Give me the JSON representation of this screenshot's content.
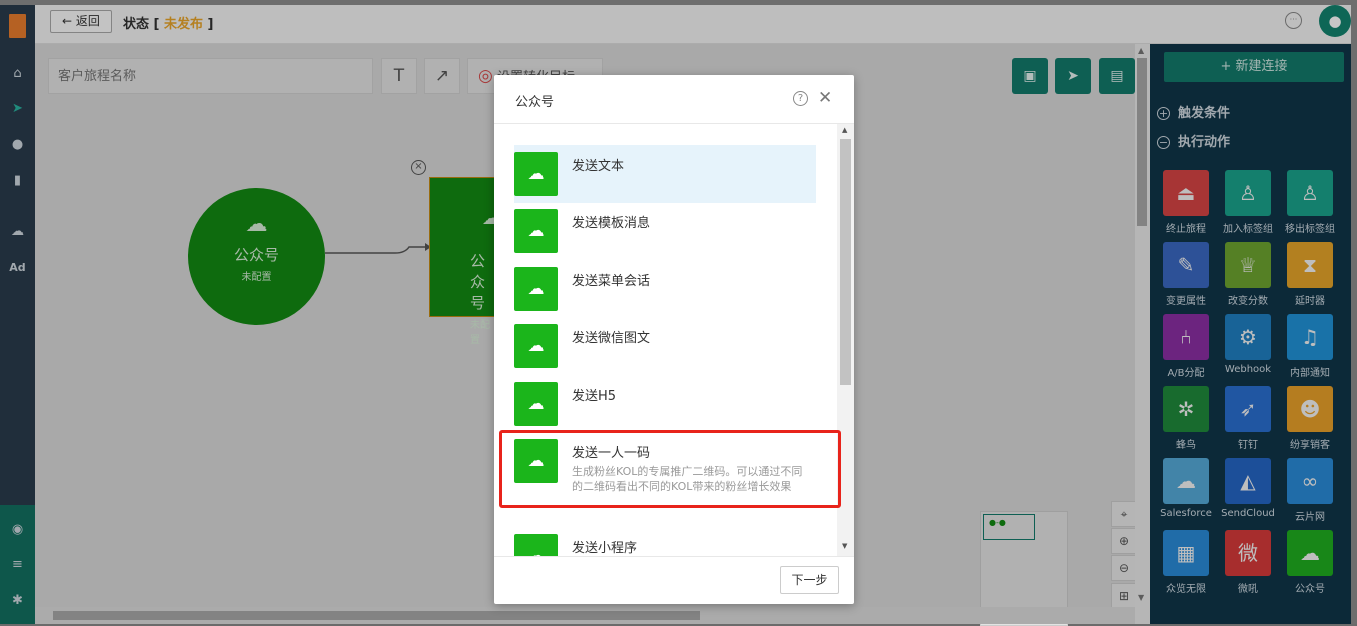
{
  "header": {
    "back_label": "返回",
    "status_prefix": "状态 [ ",
    "status_value": "未发布",
    "status_suffix": " ]"
  },
  "toolbar": {
    "journey_name_placeholder": "客户旅程名称",
    "text_tool": "T",
    "arrow_tool": "↗",
    "goal_label": "设置转化目标"
  },
  "canvas": {
    "node1": {
      "name": "公众号",
      "status": "未配置"
    },
    "node2": {
      "name": "公众号",
      "status": "未配置"
    }
  },
  "right_panel": {
    "new_connection": "+ 新建连接",
    "sections": {
      "triggers": "触发条件",
      "actions": "执行动作"
    },
    "actions": [
      {
        "label": "终止旅程",
        "icon": "eject-icon",
        "color": "#d64545"
      },
      {
        "label": "加入标签组",
        "icon": "user-add-icon",
        "color": "#1aa38c"
      },
      {
        "label": "移出标签组",
        "icon": "user-remove-icon",
        "color": "#1aa38c"
      },
      {
        "label": "变更属性",
        "icon": "edit-icon",
        "color": "#3a68c2"
      },
      {
        "label": "改变分数",
        "icon": "trophy-icon",
        "color": "#6da530"
      },
      {
        "label": "延时器",
        "icon": "hourglass-icon",
        "color": "#e6a52a"
      },
      {
        "label": "A/B分配",
        "icon": "split-icon",
        "color": "#8b2fa3"
      },
      {
        "label": "Webhook",
        "icon": "webhook-icon",
        "color": "#1f7fc2"
      },
      {
        "label": "内部通知",
        "icon": "bell-icon",
        "color": "#2192d8"
      },
      {
        "label": "蜂鸟",
        "icon": "spider-icon",
        "color": "#1f8a3b"
      },
      {
        "label": "钉钉",
        "icon": "dingtalk-icon",
        "color": "#2a6fd0"
      },
      {
        "label": "纷享销客",
        "icon": "fxiaoke-icon",
        "color": "#e8a02a"
      },
      {
        "label": "Salesforce",
        "icon": "cloud-icon",
        "color": "#55a9d8"
      },
      {
        "label": "SendCloud",
        "icon": "sendcloud-icon",
        "color": "#2566c4"
      },
      {
        "label": "云片网",
        "icon": "yunpian-icon",
        "color": "#2a8bd8"
      },
      {
        "label": "众览无限",
        "icon": "zhonglan-icon",
        "color": "#2a8bd8"
      },
      {
        "label": "微吼",
        "icon": "vhall-icon",
        "color": "#d63a3a"
      },
      {
        "label": "公众号",
        "icon": "wechat-icon",
        "color": "#1fae1f"
      }
    ]
  },
  "modal": {
    "title": "公众号",
    "items": [
      {
        "title": "发送文本",
        "desc": ""
      },
      {
        "title": "发送模板消息",
        "desc": ""
      },
      {
        "title": "发送菜单会话",
        "desc": ""
      },
      {
        "title": "发送微信图文",
        "desc": ""
      },
      {
        "title": "发送H5",
        "desc": ""
      },
      {
        "title": "发送一人一码",
        "desc": "生成粉丝KOL的专属推广二维码。可以通过不同的二维码看出不同的KOL带来的粉丝增长效果"
      },
      {
        "title": "发送小程序",
        "desc": ""
      }
    ],
    "next_label": "下一步"
  }
}
